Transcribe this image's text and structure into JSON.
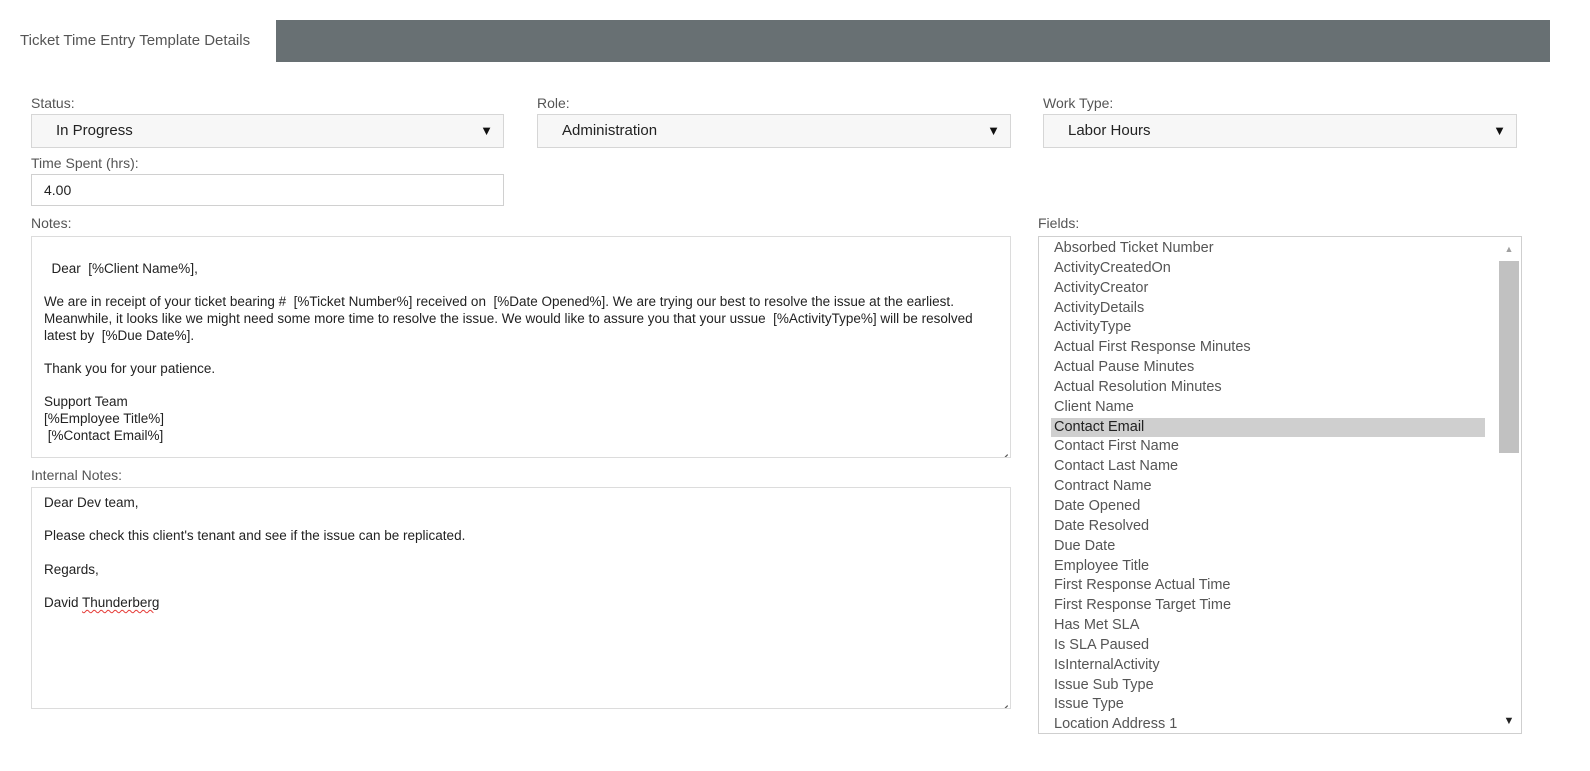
{
  "tabs": {
    "active_label": "Ticket Time Entry Template Details"
  },
  "form": {
    "status": {
      "label": "Status:",
      "value": "In Progress"
    },
    "role": {
      "label": "Role:",
      "value": "Administration"
    },
    "work_type": {
      "label": "Work Type:",
      "value": "Labor Hours"
    },
    "time_spent": {
      "label": "Time Spent (hrs):",
      "value": "4.00"
    },
    "notes": {
      "label": "Notes:",
      "value": "Dear  [%Client Name%],\n\nWe are in receipt of your ticket bearing #  [%Ticket Number%] received on  [%Date Opened%]. We are trying our best to resolve the issue at the earliest. Meanwhile, it looks like we might need some more time to resolve the issue. We would like to assure you that your ussue  [%ActivityType%] will be resolved latest by  [%Due Date%].\n\nThank you for your patience.\n\nSupport Team\n[%Employee Title%]\n [%Contact Email%]"
    },
    "internal_notes": {
      "label": "Internal Notes:",
      "lines": {
        "greeting": "Dear Dev team,",
        "body": "Please check this client's tenant and see if the issue can be replicated.",
        "closing": "Regards,",
        "signature_first": "David ",
        "signature_last": "Thunderberg"
      }
    }
  },
  "fields": {
    "label": "Fields:",
    "selected": "Contact Email",
    "items": [
      "Absorbed Ticket Number",
      "ActivityCreatedOn",
      "ActivityCreator",
      "ActivityDetails",
      "ActivityType",
      "Actual First Response Minutes",
      "Actual Pause Minutes",
      "Actual Resolution Minutes",
      "Client Name",
      "Contact Email",
      "Contact First Name",
      "Contact Last Name",
      "Contract Name",
      "Date Opened",
      "Date Resolved",
      "Due Date",
      "Employee Title",
      "First Response Actual Time",
      "First Response Target Time",
      "Has Met SLA",
      "Is SLA Paused",
      "IsInternalActivity",
      "Issue Sub Type",
      "Issue Type",
      "Location Address 1"
    ]
  },
  "icons": {
    "dropdown_caret": "▼",
    "scroll_up": "▲",
    "scroll_down": "▼"
  }
}
